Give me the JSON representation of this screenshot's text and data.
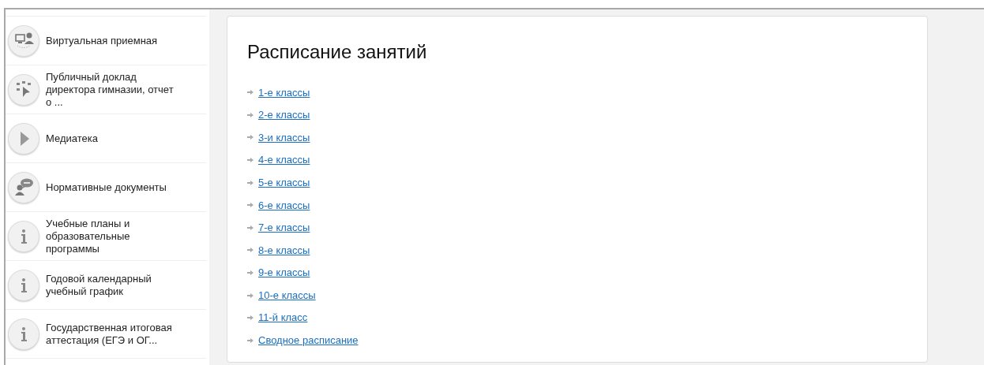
{
  "sidebar": {
    "items": [
      {
        "kind": "people",
        "label": "Виртуальная приемная"
      },
      {
        "kind": "pointer",
        "label": "Публичный доклад директора гимназии, отчет о ..."
      },
      {
        "kind": "play",
        "label": "Медиатека"
      },
      {
        "kind": "chat",
        "label": "Нормативные документы"
      },
      {
        "kind": "info",
        "label": "Учебные планы и образовательные программы"
      },
      {
        "kind": "info",
        "label": "Годовой календарный учебный график"
      },
      {
        "kind": "info",
        "label": "Государственная итоговая аттестация (ЕГЭ и ОГ..."
      }
    ]
  },
  "content": {
    "title": "Расписание занятий",
    "links": [
      "1-е классы",
      "2-е классы",
      "3-и классы",
      "4-е классы",
      "5-е классы",
      "6-е классы",
      "7-е классы",
      "8-е классы",
      "9-е классы",
      "10-е классы",
      "11-й класс",
      "Сводное расписание"
    ]
  }
}
